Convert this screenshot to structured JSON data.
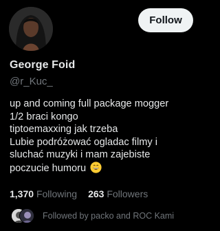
{
  "profile": {
    "display_name": "George Foid",
    "handle": "@r_Kuc_",
    "avatar_icon": "profile-photo",
    "follow_label": "Follow",
    "bio_lines": [
      "up and coming full package mogger",
      "1/2 braci kongo",
      "tiptoemaxxing jak trzeba",
      "Lubie podróżować ogladac filmy i",
      "sluchać muzyki i mam zajebiste",
      "poczucie humoru"
    ],
    "bio_emoji": "grinning-face-emoji"
  },
  "stats": {
    "following_count": "1,370",
    "following_label": "Following",
    "followers_count": "263",
    "followers_label": "Followers"
  },
  "followed_by": {
    "text": "Followed by packo and ROC Kami",
    "avatar_icons": [
      "follower-avatar-packo",
      "follower-avatar-roc-kami"
    ]
  },
  "colors": {
    "background": "#000000",
    "primary_text": "#e7e9ea",
    "secondary_text": "#71767b",
    "follow_button_bg": "#eff3f4",
    "follow_button_text": "#0f1419"
  }
}
